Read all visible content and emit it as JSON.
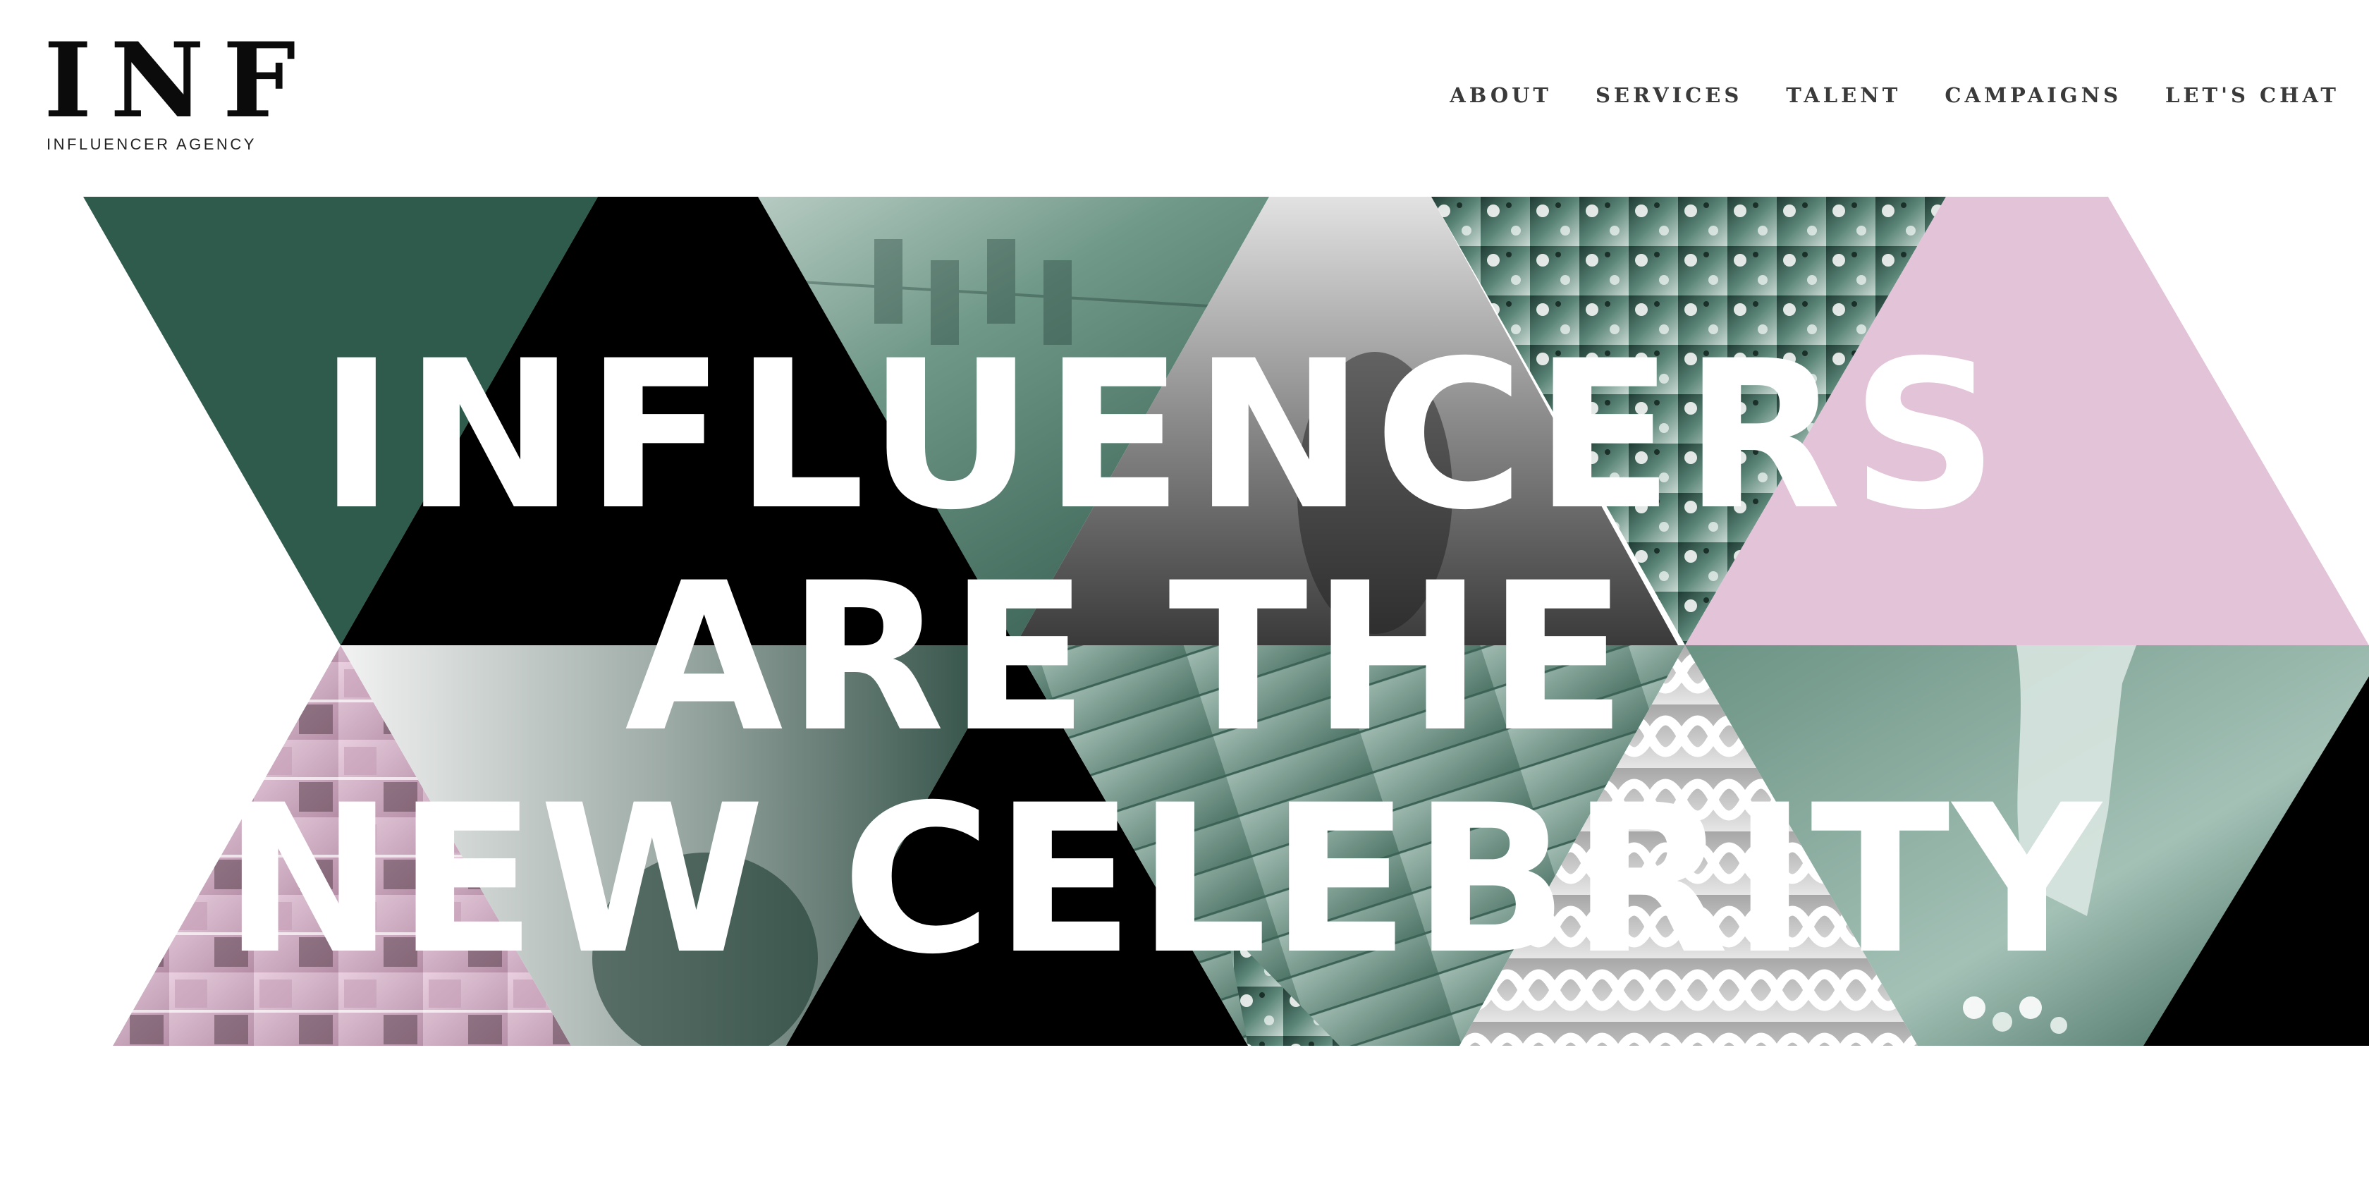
{
  "brand": {
    "logo_mark": "INF",
    "logo_subtitle": "INFLUENCER AGENCY"
  },
  "nav": {
    "items": [
      {
        "label": "ABOUT"
      },
      {
        "label": "SERVICES"
      },
      {
        "label": "TALENT"
      },
      {
        "label": "CAMPAIGNS"
      },
      {
        "label": "LET'S CHAT"
      }
    ]
  },
  "hero": {
    "headline": {
      "line1": "INFLUENCERS",
      "line2": "ARE THE",
      "line3": "NEW CELEBRITY"
    }
  },
  "colors": {
    "green": "#2f5b4d",
    "pink": "#e3c3d8",
    "black": "#000000",
    "text": "#ffffff",
    "nav_text": "#3a3a3a"
  }
}
